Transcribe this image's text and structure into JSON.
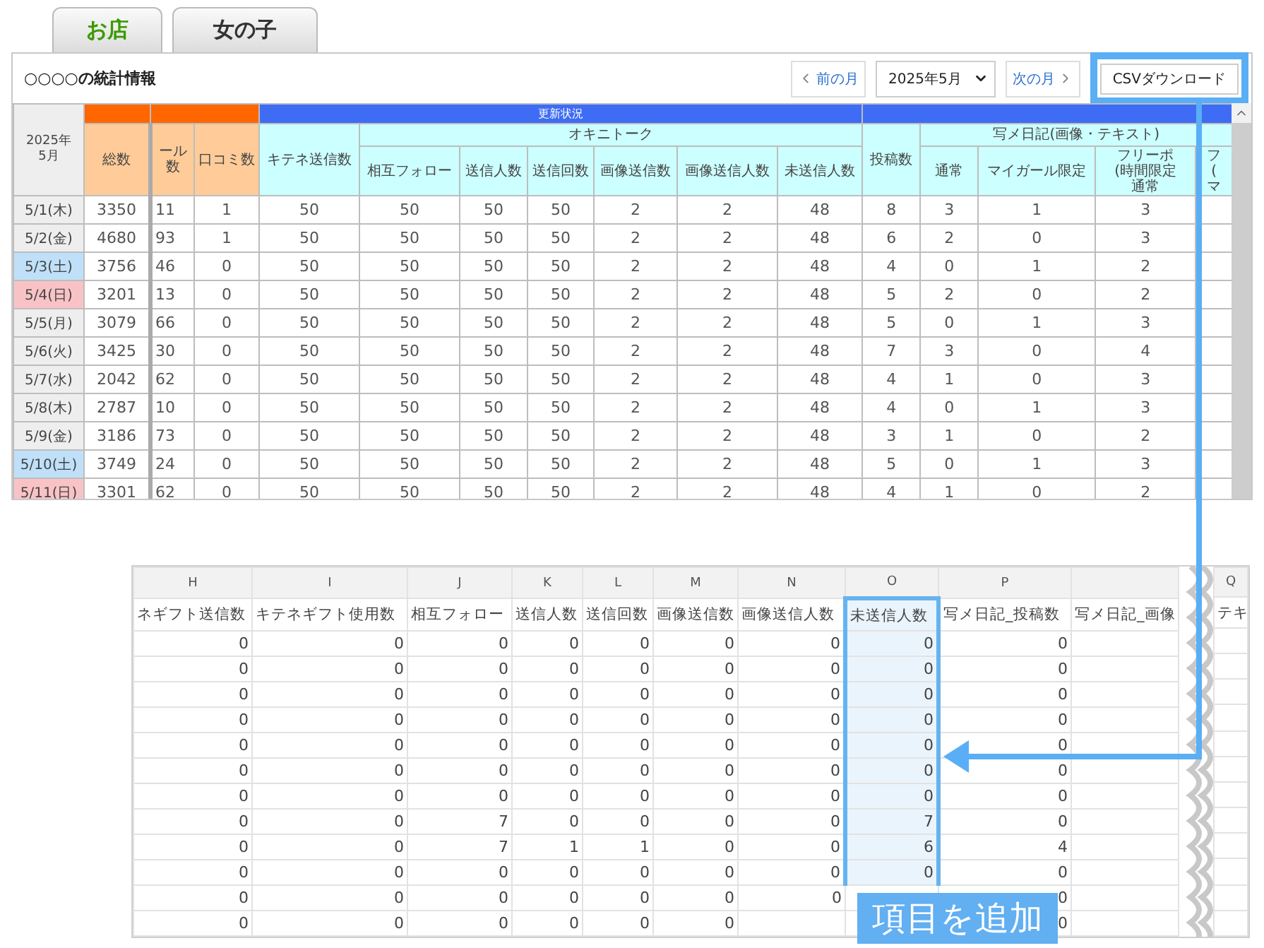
{
  "tabs": [
    {
      "label": "お店",
      "selected": false
    },
    {
      "label": "女の子",
      "selected": true
    }
  ],
  "panel": {
    "title": "○○○○の統計情報",
    "prev_button": "前の月",
    "month_select": "2025年5月",
    "next_button": "次の月",
    "csv_button": "CSVダウンロード"
  },
  "stats_table": {
    "corner": [
      "2025年",
      "5月"
    ],
    "groups": [
      {
        "color": "#ff6600",
        "columns": [
          {
            "label": "総数"
          }
        ]
      },
      {
        "color": "#ff6600",
        "columns": [
          {
            "label": "ール数",
            "cut": true
          },
          {
            "label": "口コミ数"
          }
        ]
      },
      {
        "color": "#3f6cf5",
        "label": "更新状況",
        "columns": [
          {
            "label": "キテネ送信数"
          },
          {
            "label": "オキニトーク",
            "columns": [
              {
                "label": "相互フォロー"
              },
              {
                "label": "送信人数"
              },
              {
                "label": "送信回数"
              },
              {
                "label": "画像送信数"
              },
              {
                "label": "画像送信人数"
              },
              {
                "label": "未送信人数"
              }
            ]
          }
        ]
      },
      {
        "color": "#3f6cf5",
        "columns": [
          {
            "label": "投稿数"
          },
          {
            "label": "写メ日記(画像・テキスト)",
            "columns": [
              {
                "label": "通常"
              },
              {
                "label": "マイガール限定"
              },
              {
                "lines": [
                  "フリーポ",
                  "(時間限定",
                  "通常"
                ]
              },
              {
                "lines": [
                  "フ",
                  "(",
                  "マ"
                ]
              }
            ]
          }
        ]
      }
    ],
    "rows": [
      {
        "date": "5/1(木)",
        "kind": "weekday",
        "values": [
          "3350",
          "11",
          "1",
          "50",
          "50",
          "50",
          "50",
          "2",
          "2",
          "48",
          "8",
          "3",
          "1",
          "3"
        ]
      },
      {
        "date": "5/2(金)",
        "kind": "weekday",
        "values": [
          "4680",
          "93",
          "1",
          "50",
          "50",
          "50",
          "50",
          "2",
          "2",
          "48",
          "6",
          "2",
          "0",
          "3"
        ]
      },
      {
        "date": "5/3(土)",
        "kind": "saturday",
        "values": [
          "3756",
          "46",
          "0",
          "50",
          "50",
          "50",
          "50",
          "2",
          "2",
          "48",
          "4",
          "0",
          "1",
          "2"
        ]
      },
      {
        "date": "5/4(日)",
        "kind": "sunday",
        "values": [
          "3201",
          "13",
          "0",
          "50",
          "50",
          "50",
          "50",
          "2",
          "2",
          "48",
          "5",
          "2",
          "0",
          "2"
        ]
      },
      {
        "date": "5/5(月)",
        "kind": "weekday",
        "values": [
          "3079",
          "66",
          "0",
          "50",
          "50",
          "50",
          "50",
          "2",
          "2",
          "48",
          "5",
          "0",
          "1",
          "3"
        ]
      },
      {
        "date": "5/6(火)",
        "kind": "weekday",
        "values": [
          "3425",
          "30",
          "0",
          "50",
          "50",
          "50",
          "50",
          "2",
          "2",
          "48",
          "7",
          "3",
          "0",
          "4"
        ]
      },
      {
        "date": "5/7(水)",
        "kind": "weekday",
        "values": [
          "2042",
          "62",
          "0",
          "50",
          "50",
          "50",
          "50",
          "2",
          "2",
          "48",
          "4",
          "1",
          "0",
          "3"
        ]
      },
      {
        "date": "5/8(木)",
        "kind": "weekday",
        "values": [
          "2787",
          "10",
          "0",
          "50",
          "50",
          "50",
          "50",
          "2",
          "2",
          "48",
          "4",
          "0",
          "1",
          "3"
        ]
      },
      {
        "date": "5/9(金)",
        "kind": "weekday",
        "values": [
          "3186",
          "73",
          "0",
          "50",
          "50",
          "50",
          "50",
          "2",
          "2",
          "48",
          "3",
          "1",
          "0",
          "2"
        ]
      },
      {
        "date": "5/10(土)",
        "kind": "saturday",
        "values": [
          "3749",
          "24",
          "0",
          "50",
          "50",
          "50",
          "50",
          "2",
          "2",
          "48",
          "5",
          "0",
          "1",
          "3"
        ]
      },
      {
        "date": "5/11(日)",
        "kind": "sunday",
        "values": [
          "3301",
          "62",
          "0",
          "50",
          "50",
          "50",
          "50",
          "2",
          "2",
          "48",
          "4",
          "1",
          "0",
          "2"
        ]
      }
    ]
  },
  "sheet": {
    "columns": [
      {
        "letter": "H",
        "name": "ネギフト送信数",
        "selected": false
      },
      {
        "letter": "I",
        "name": "キテネギフト使用数",
        "selected": false
      },
      {
        "letter": "J",
        "name": "相互フォロー",
        "selected": false
      },
      {
        "letter": "K",
        "name": "送信人数",
        "selected": false
      },
      {
        "letter": "L",
        "name": "送信回数",
        "selected": false
      },
      {
        "letter": "M",
        "name": "画像送信数",
        "selected": false
      },
      {
        "letter": "N",
        "name": "画像送信人数",
        "selected": false
      },
      {
        "letter": "O",
        "name": "未送信人数",
        "selected": true
      },
      {
        "letter": "P",
        "name": "写メ日記_投稿数",
        "selected": false
      },
      {
        "name": "写メ日記_画像",
        "selected": false
      }
    ],
    "last_column": {
      "letter": "Q",
      "name": "テキ"
    },
    "rows": [
      [
        "0",
        "0",
        "0",
        "0",
        "0",
        "0",
        "0",
        "0",
        "0"
      ],
      [
        "0",
        "0",
        "0",
        "0",
        "0",
        "0",
        "0",
        "0",
        "0"
      ],
      [
        "0",
        "0",
        "0",
        "0",
        "0",
        "0",
        "0",
        "0",
        "0"
      ],
      [
        "0",
        "0",
        "0",
        "0",
        "0",
        "0",
        "0",
        "0",
        "0"
      ],
      [
        "0",
        "0",
        "0",
        "0",
        "0",
        "0",
        "0",
        "0",
        "0"
      ],
      [
        "0",
        "0",
        "0",
        "0",
        "0",
        "0",
        "0",
        "0",
        "0"
      ],
      [
        "0",
        "0",
        "0",
        "0",
        "0",
        "0",
        "0",
        "0",
        "0"
      ],
      [
        "0",
        "0",
        "7",
        "0",
        "0",
        "0",
        "0",
        "7",
        "0"
      ],
      [
        "0",
        "0",
        "7",
        "1",
        "1",
        "0",
        "0",
        "6",
        "4"
      ],
      [
        "0",
        "0",
        "0",
        "0",
        "0",
        "0",
        "0",
        "0",
        "0"
      ],
      [
        "0",
        "0",
        "0",
        "0",
        "0",
        "0",
        "0",
        null,
        "0"
      ],
      [
        "0",
        "0",
        "0",
        "0",
        "0",
        "0",
        null,
        null,
        "0"
      ]
    ]
  },
  "callout": {
    "label": "項目を追加"
  }
}
